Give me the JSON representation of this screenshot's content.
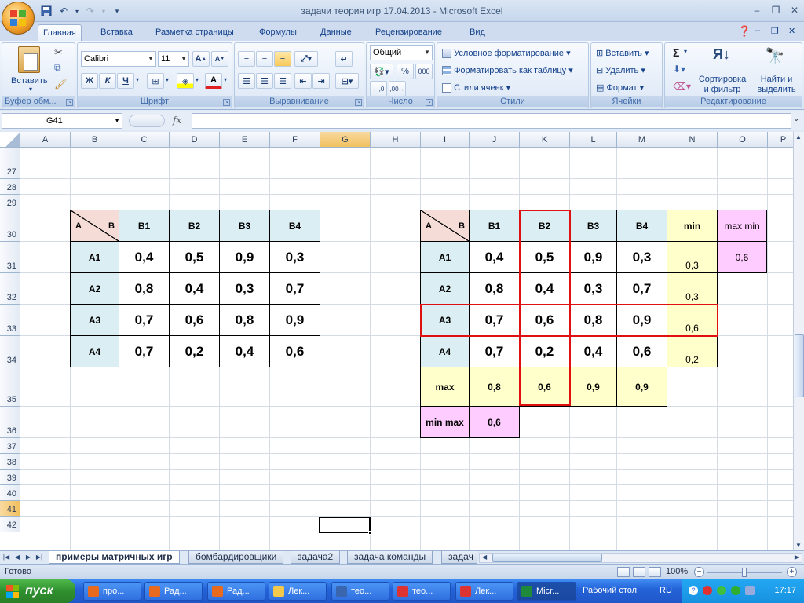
{
  "window": {
    "title": "задачи теория игр 17.04.2013 - Microsoft Excel"
  },
  "tabs": [
    "Главная",
    "Вставка",
    "Разметка страницы",
    "Формулы",
    "Данные",
    "Рецензирование",
    "Вид"
  ],
  "ribbon": {
    "clipboard": {
      "paste": "Вставить",
      "label": "Буфер обм..."
    },
    "font": {
      "name": "Calibri",
      "size": "11",
      "label": "Шрифт",
      "bold": "Ж",
      "italic": "К",
      "underline": "Ч"
    },
    "alignment": {
      "label": "Выравнивание"
    },
    "number": {
      "format": "Общий",
      "percent": "%",
      "thousands": "000",
      "label": "Число"
    },
    "styles": {
      "cond": "Условное форматирование",
      "table": "Форматировать как таблицу",
      "cell": "Стили ячеек",
      "label": "Стили"
    },
    "cells": {
      "insert": "Вставить",
      "delete": "Удалить",
      "format": "Формат",
      "label": "Ячейки"
    },
    "editing": {
      "sum": "Σ",
      "sort1": "Сортировка",
      "sort2": "и фильтр",
      "find1": "Найти и",
      "find2": "выделить",
      "label": "Редактирование"
    }
  },
  "formula_bar": {
    "name_box": "G41",
    "fx": "fx",
    "value": ""
  },
  "grid": {
    "columns": [
      "A",
      "B",
      "C",
      "D",
      "E",
      "F",
      "G",
      "H",
      "I",
      "J",
      "K",
      "L",
      "M",
      "N",
      "O",
      "P"
    ],
    "selected_column": "G",
    "rows": [
      "27",
      "28",
      "29",
      "30",
      "31",
      "32",
      "33",
      "34",
      "35",
      "36",
      "37",
      "38",
      "39",
      "40",
      "41",
      "42"
    ],
    "selected_row": "41"
  },
  "table1": {
    "corner_a": "A",
    "corner_b": "B",
    "col_headers": [
      "B1",
      "B2",
      "B3",
      "B4"
    ],
    "row_headers": [
      "A1",
      "A2",
      "A3",
      "A4"
    ],
    "values": [
      [
        "0,4",
        "0,5",
        "0,9",
        "0,3"
      ],
      [
        "0,8",
        "0,4",
        "0,3",
        "0,7"
      ],
      [
        "0,7",
        "0,6",
        "0,8",
        "0,9"
      ],
      [
        "0,7",
        "0,2",
        "0,4",
        "0,6"
      ]
    ]
  },
  "table2": {
    "corner_a": "A",
    "corner_b": "B",
    "col_headers": [
      "B1",
      "B2",
      "B3",
      "B4"
    ],
    "min_header": "min",
    "maxmin_header": "max min",
    "maxmin_value": "0,6",
    "row_headers": [
      "A1",
      "A2",
      "A3",
      "A4"
    ],
    "values": [
      [
        "0,4",
        "0,5",
        "0,9",
        "0,3"
      ],
      [
        "0,8",
        "0,4",
        "0,3",
        "0,7"
      ],
      [
        "0,7",
        "0,6",
        "0,8",
        "0,9"
      ],
      [
        "0,7",
        "0,2",
        "0,4",
        "0,6"
      ]
    ],
    "row_mins": [
      "0,3",
      "0,3",
      "0,6",
      "0,2"
    ],
    "max_label": "max",
    "col_maxes": [
      "0,8",
      "0,6",
      "0,9",
      "0,9"
    ],
    "minmax_label": "min max",
    "minmax_value": "0,6"
  },
  "sheets": [
    "примеры матричных игр",
    "бомбардировщики",
    "задача2",
    "задача команды",
    "задач"
  ],
  "active_sheet": "примеры матричных игр",
  "status": {
    "text": "Готово",
    "zoom": "100%",
    "zoom_level": 0.5
  },
  "taskbar": {
    "start": "пуск",
    "tasks": [
      "про...",
      "Рад...",
      "Рад...",
      "Лек...",
      "тео...",
      "тео...",
      "Лек...",
      "Micr..."
    ],
    "desktop": "Рабочий стол",
    "lang": "RU",
    "clock": "17:17"
  },
  "colors": {
    "accent": "#15428b",
    "highlight_border": "#e01010",
    "header_fill": "#daeef3",
    "yellow_fill": "#ffffcc",
    "pink_fill": "#ffccff",
    "corner_fill": "#f5dcd6"
  }
}
